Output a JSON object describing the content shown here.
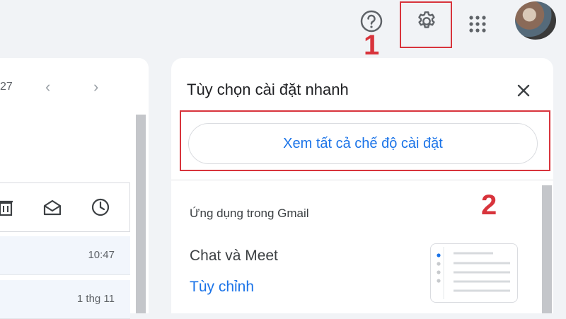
{
  "annotations": {
    "step1": "1",
    "step2": "2"
  },
  "mail": {
    "page_count": "27",
    "rows": [
      {
        "time": "10:47"
      },
      {
        "time": "1 thg 11"
      }
    ]
  },
  "quick_settings": {
    "title": "Tùy chọn cài đặt nhanh",
    "see_all_label": "Xem tất cả chế độ cài đặt",
    "section_label": "Ứng dụng trong Gmail",
    "chat_label": "Chat và Meet",
    "customize_label": "Tùy chỉnh"
  },
  "colors": {
    "accent": "#1a73e8",
    "highlight": "#d8343c"
  },
  "icons": [
    "help-icon",
    "settings-icon",
    "apps-icon",
    "trash-icon",
    "mail-open-icon",
    "clock-icon",
    "close-icon"
  ]
}
